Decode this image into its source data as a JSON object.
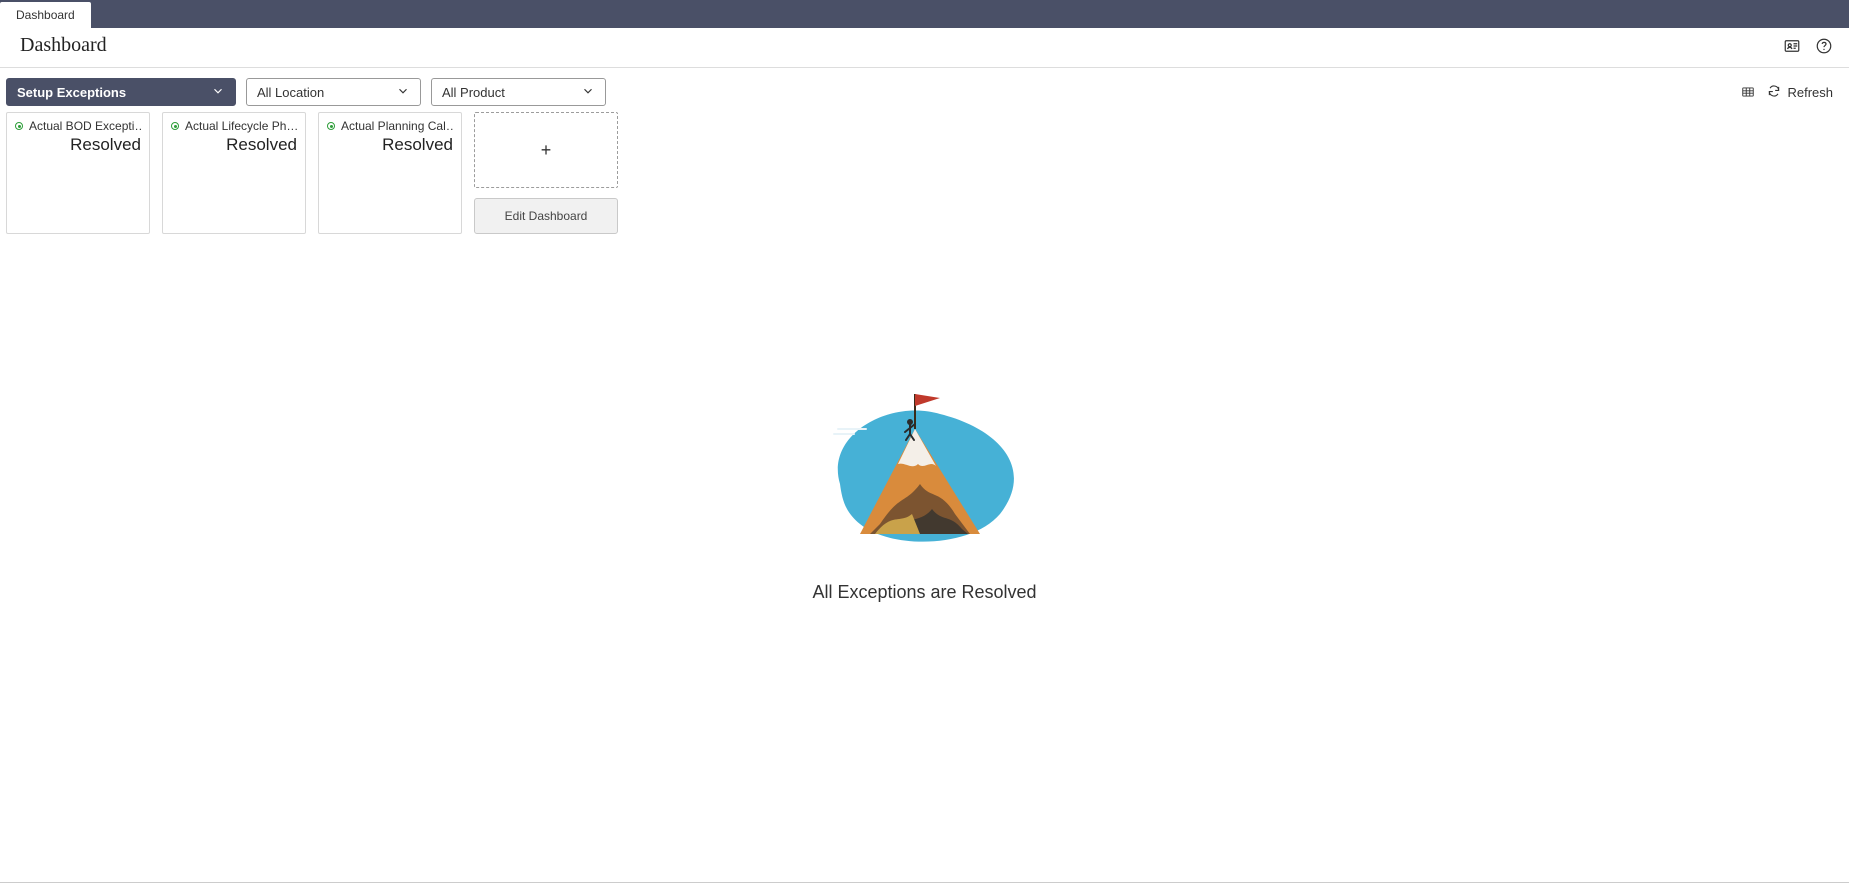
{
  "tabs": {
    "active": "Dashboard"
  },
  "page": {
    "title": "Dashboard"
  },
  "toolbar": {
    "setup_label": "Setup Exceptions",
    "location_label": "All Location",
    "product_label": "All Product",
    "refresh_label": "Refresh"
  },
  "cards": [
    {
      "title": "Actual BOD Excepti…",
      "status": "Resolved"
    },
    {
      "title": "Actual Lifecycle Ph…",
      "status": "Resolved"
    },
    {
      "title": "Actual Planning Cal…",
      "status": "Resolved"
    }
  ],
  "add": {
    "plus": "+",
    "edit_label": "Edit Dashboard"
  },
  "empty": {
    "message": "All Exceptions are Resolved"
  }
}
